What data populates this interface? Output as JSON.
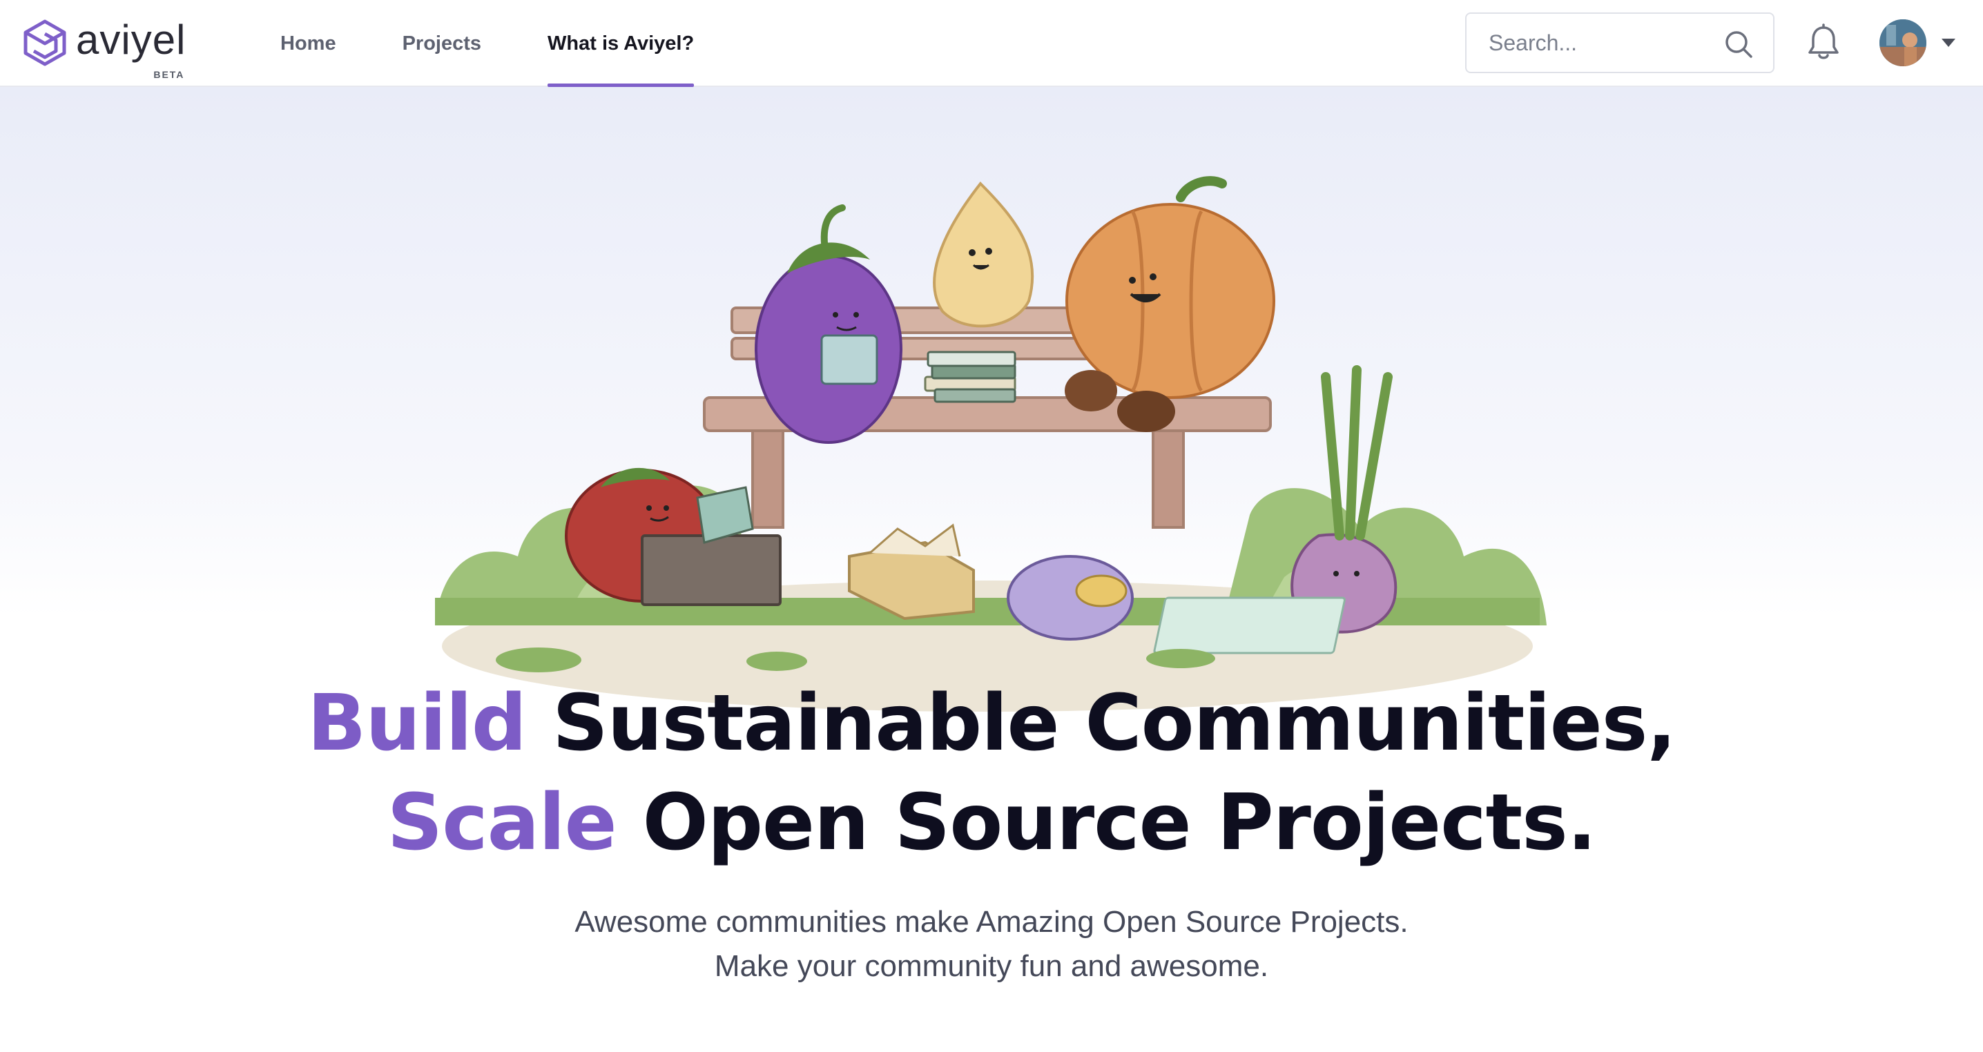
{
  "brand": {
    "name": "aviyel",
    "badge": "BETA",
    "accent_color": "#7e5fc9"
  },
  "nav": {
    "items": [
      {
        "label": "Home",
        "active": false
      },
      {
        "label": "Projects",
        "active": false
      },
      {
        "label": "What is Aviyel?",
        "active": true
      }
    ]
  },
  "search": {
    "placeholder": "Search...",
    "value": ""
  },
  "icons": {
    "search": "search-icon",
    "notifications": "bell-icon",
    "user_menu": "chevron-down-icon",
    "avatar": "avatar"
  },
  "hero": {
    "line1_accent": "Build",
    "line1_rest": " Sustainable Communities,",
    "line2_accent": "Scale",
    "line2_rest": " Open Source Projects.",
    "subtitle_line1": "Awesome communities make Amazing Open Source Projects.",
    "subtitle_line2": "Make your community fun and awesome.",
    "accent_color": "#7d5cc6"
  }
}
